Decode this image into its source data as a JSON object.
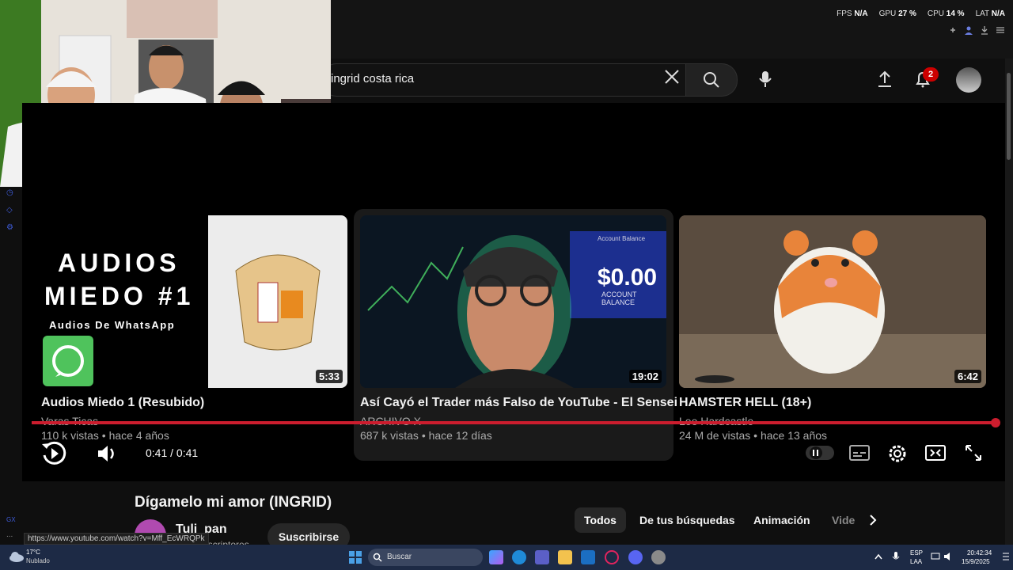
{
  "overlay": {
    "fps_label": "FPS",
    "fps_value": "N/A",
    "gpu_label": "GPU",
    "gpu_value": "27 %",
    "cpu_label": "CPU",
    "cpu_value": "14 %",
    "lat_label": "LAT",
    "lat_value": "N/A"
  },
  "header": {
    "search_value": "ingrid costa rica",
    "notification_count": "2"
  },
  "cards": [
    {
      "thumb_line1": "AUDIOS",
      "thumb_line2": "MIEDO #1",
      "thumb_line3": "Audios De WhatsApp",
      "duration": "5:33",
      "title": "Audios Miedo 1 (Resubido)",
      "channel": "Varas Ticas",
      "meta": "110 k vistas • hace 4 años"
    },
    {
      "thumb_price": "$0.00",
      "thumb_caption": "ACCOUNT BALANCE",
      "thumb_header": "Account Balance",
      "duration": "19:02",
      "title": "Así Cayó el Trader más Falso de YouTube - El Sensei",
      "channel": "ARCHIVO X",
      "meta": "687 k vistas • hace 12 días"
    },
    {
      "duration": "6:42",
      "title": "HAMSTER HELL (18+)",
      "channel": "Lee Hardcastle",
      "meta": "24 M de vistas • hace 13 años"
    }
  ],
  "player": {
    "time": "0:41 / 0:41",
    "progress_fraction": 1.0
  },
  "below": {
    "video_title": "Dígamelo mi amor (INGRID)",
    "channel_name": "Tuli_pan",
    "channel_subs": "suscriptores",
    "subscribe_label": "Suscribirse",
    "chips": [
      "Todos",
      "De tus búsquedas",
      "Animación",
      "Vide"
    ],
    "url_tooltip": "https://www.youtube.com/watch?v=Mff_EcWRQPk"
  },
  "sidebar_text": [
    "GX",
    "..."
  ],
  "taskbar": {
    "weather_temp": "17°C",
    "weather_desc": "Nublado",
    "search_placeholder": "Buscar",
    "lang_line1": "ESP",
    "lang_line2": "LAA",
    "time": "20:42:34",
    "date": "15/9/2025"
  },
  "colors": {
    "accent_red": "#cc1d2e",
    "background": "#0f0f0f",
    "taskbar": "#1d2a45"
  }
}
